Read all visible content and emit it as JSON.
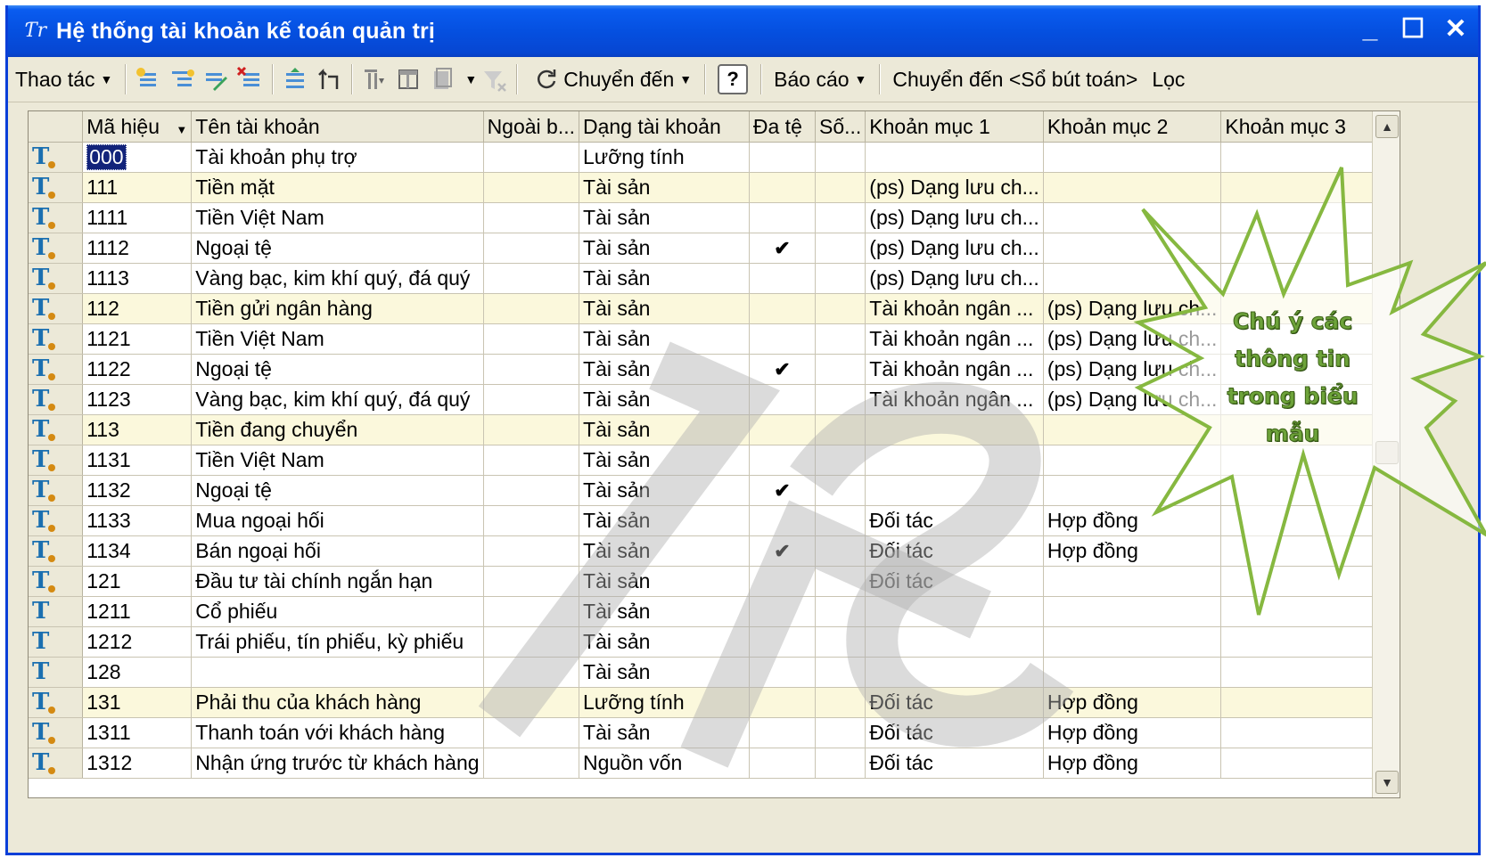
{
  "window": {
    "title": "Hệ thống tài khoản kế toán quản trị",
    "minimize": "_",
    "maximize": "☐",
    "close": "✕"
  },
  "toolbar": {
    "actions_label": "Thao tác",
    "goto_label": "Chuyển đến",
    "help_label": "?",
    "reports_label": "Báo cáo",
    "goto_journal_label": "Chuyển đến <Sổ bút toán>",
    "filter_label": "Lọc"
  },
  "grid": {
    "columns": [
      "Mã hiệu",
      "Tên tài khoản",
      "Ngoài b...",
      "Dạng tài khoản",
      "Đa tệ",
      "Số...",
      "Khoản mục 1",
      "Khoản mục 2",
      "Khoản mục 3"
    ],
    "rows": [
      {
        "code": "000",
        "name": "Tài khoản phụ trợ",
        "type": "Lưỡng tính",
        "multi": "",
        "km1": "",
        "km2": "",
        "hl": false,
        "dot": true
      },
      {
        "code": "111",
        "name": "Tiền mặt",
        "type": "Tài sản",
        "multi": "",
        "km1": "(ps) Dạng lưu ch...",
        "km2": "",
        "hl": true,
        "dot": true
      },
      {
        "code": "1111",
        "name": "Tiền Việt Nam",
        "type": "Tài sản",
        "multi": "",
        "km1": "(ps) Dạng lưu ch...",
        "km2": "",
        "hl": false,
        "dot": true
      },
      {
        "code": "1112",
        "name": "Ngoại tệ",
        "type": "Tài sản",
        "multi": "✔",
        "km1": "(ps) Dạng lưu ch...",
        "km2": "",
        "hl": false,
        "dot": true
      },
      {
        "code": "1113",
        "name": "Vàng bạc, kim khí quý, đá quý",
        "type": "Tài sản",
        "multi": "",
        "km1": "(ps) Dạng lưu ch...",
        "km2": "",
        "hl": false,
        "dot": true
      },
      {
        "code": "112",
        "name": "Tiền gửi ngân hàng",
        "type": "Tài sản",
        "multi": "",
        "km1": "Tài khoản ngân ...",
        "km2": "(ps) Dạng lưu ch...",
        "hl": true,
        "dot": true
      },
      {
        "code": "1121",
        "name": "Tiền Việt Nam",
        "type": "Tài sản",
        "multi": "",
        "km1": "Tài khoản ngân ...",
        "km2": "(ps) Dạng lưu ch...",
        "hl": false,
        "dot": true
      },
      {
        "code": "1122",
        "name": "Ngoại tệ",
        "type": "Tài sản",
        "multi": "✔",
        "km1": "Tài khoản ngân ...",
        "km2": "(ps) Dạng lưu ch...",
        "hl": false,
        "dot": true
      },
      {
        "code": "1123",
        "name": "Vàng bạc, kim khí quý, đá quý",
        "type": "Tài sản",
        "multi": "",
        "km1": "Tài khoản ngân ...",
        "km2": "(ps) Dạng lưu ch...",
        "hl": false,
        "dot": true
      },
      {
        "code": "113",
        "name": "Tiền đang chuyển",
        "type": "Tài sản",
        "multi": "",
        "km1": "",
        "km2": "",
        "hl": true,
        "dot": true
      },
      {
        "code": "1131",
        "name": "Tiền Việt Nam",
        "type": "Tài sản",
        "multi": "",
        "km1": "",
        "km2": "",
        "hl": false,
        "dot": true
      },
      {
        "code": "1132",
        "name": "Ngoại tệ",
        "type": "Tài sản",
        "multi": "✔",
        "km1": "",
        "km2": "",
        "hl": false,
        "dot": true
      },
      {
        "code": "1133",
        "name": "Mua ngoại hối",
        "type": "Tài sản",
        "multi": "",
        "km1": "Đối tác",
        "km2": "Hợp đồng",
        "hl": false,
        "dot": true
      },
      {
        "code": "1134",
        "name": "Bán ngoại hối",
        "type": "Tài sản",
        "multi": "✔",
        "km1": "Đối tác",
        "km2": "Hợp đồng",
        "hl": false,
        "dot": true
      },
      {
        "code": "121",
        "name": "Đầu tư tài chính ngắn hạn",
        "type": "Tài sản",
        "multi": "",
        "km1": "Đối tác",
        "km2": "",
        "hl": false,
        "dot": true
      },
      {
        "code": "1211",
        "name": "Cổ phiếu",
        "type": "Tài sản",
        "multi": "",
        "km1": "",
        "km2": "",
        "hl": false,
        "dot": false
      },
      {
        "code": "1212",
        "name": "Trái phiếu, tín phiếu, kỳ phiếu",
        "type": "Tài sản",
        "multi": "",
        "km1": "",
        "km2": "",
        "hl": false,
        "dot": false
      },
      {
        "code": "128",
        "name": "",
        "type": "Tài sản",
        "multi": "",
        "km1": "",
        "km2": "",
        "hl": false,
        "dot": false
      },
      {
        "code": "131",
        "name": "Phải thu của khách hàng",
        "type": "Lưỡng tính",
        "multi": "",
        "km1": "Đối tác",
        "km2": "Hợp đồng",
        "hl": true,
        "dot": true
      },
      {
        "code": "1311",
        "name": "Thanh toán với khách hàng",
        "type": "Tài sản",
        "multi": "",
        "km1": "Đối tác",
        "km2": "Hợp đồng",
        "hl": false,
        "dot": true
      },
      {
        "code": "1312",
        "name": "Nhận ứng trước từ khách hàng",
        "type": "Nguồn vốn",
        "multi": "",
        "km1": "Đối tác",
        "km2": "Hợp đồng",
        "hl": false,
        "dot": true
      }
    ]
  },
  "callout": {
    "line1": "Chú ý các",
    "line2": "thông tin",
    "line3": "trong biểu",
    "line4": "mẫu"
  },
  "watermark": "1VS",
  "colors": {
    "titlebar": "#0550e0",
    "highlight_row": "#fbf8dc",
    "selection": "#12237a",
    "callout": "#6da33a",
    "window_bg": "#ece9d8"
  }
}
